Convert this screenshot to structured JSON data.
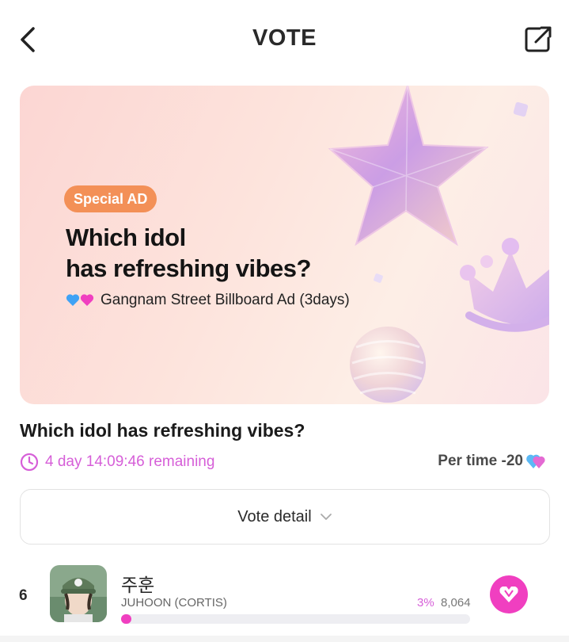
{
  "header": {
    "title": "VOTE",
    "back_icon": "chevron-left-icon",
    "share_icon": "share-icon"
  },
  "banner": {
    "badge": "Special AD",
    "headline_line1": "Which idol",
    "headline_line2": "has refreshing vibes?",
    "subtitle": "Gangnam Street Billboard Ad (3days)",
    "badge_color": "#f39057"
  },
  "vote": {
    "title": "Which idol has refreshing vibes?",
    "remaining": "4 day 14:09:46 remaining",
    "per_time": "Per time -20",
    "accent_color": "#d65fd8"
  },
  "detail": {
    "label": "Vote detail"
  },
  "rankings": [
    {
      "rank": "6",
      "name_ko": "주훈",
      "name_en": "JUHOON (CORTIS)",
      "percent": "3%",
      "votes": "8,064",
      "fill": 0.03
    }
  ]
}
